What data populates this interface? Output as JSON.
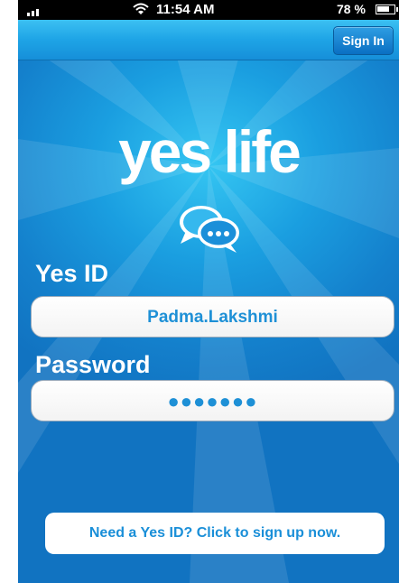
{
  "status_bar": {
    "time": "11:54 AM",
    "battery": "78 %"
  },
  "nav": {
    "sign_in_label": "Sign In"
  },
  "logo": {
    "text": "yes life"
  },
  "form": {
    "yes_id_label": "Yes ID",
    "yes_id_value": "Padma.Lakshmi",
    "password_label": "Password",
    "password_value": "●●●●●●●"
  },
  "signup": {
    "label": "Need a Yes ID? Click to sign up now."
  },
  "colors": {
    "accent": "#1a8fd8",
    "background": "#1480cc"
  },
  "icons": [
    "signal-icon",
    "wifi-icon",
    "battery-icon",
    "chat-bubbles-icon"
  ]
}
